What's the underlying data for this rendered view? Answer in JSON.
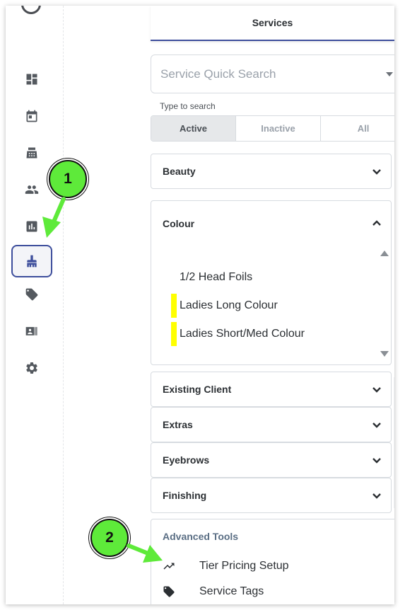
{
  "sidebar": {
    "items": [
      {
        "name": "dashboard-icon"
      },
      {
        "name": "calendar-icon"
      },
      {
        "name": "cash-register-icon"
      },
      {
        "name": "clients-icon"
      },
      {
        "name": "reports-icon"
      },
      {
        "name": "services-brush-icon",
        "active": true
      },
      {
        "name": "tag-icon"
      },
      {
        "name": "contact-barcode-icon"
      },
      {
        "name": "gear-icon"
      }
    ]
  },
  "header": {
    "tab_label": "Services"
  },
  "search": {
    "placeholder": "Service Quick Search",
    "hint": "Type to search"
  },
  "filters": {
    "active": "Active",
    "inactive": "Inactive",
    "all": "All",
    "selected": "Active"
  },
  "categories": {
    "beauty": "Beauty",
    "colour": "Colour",
    "existing_client": "Existing Client",
    "extras": "Extras",
    "eyebrows": "Eyebrows",
    "finishing": "Finishing"
  },
  "colour_services": [
    {
      "label": "1/2 Head Foils",
      "highlighted": false
    },
    {
      "label": "Ladies Long Colour",
      "highlighted": true
    },
    {
      "label": "Ladies Short/Med Colour",
      "highlighted": true
    }
  ],
  "advanced_tools": {
    "title": "Advanced Tools",
    "tier_pricing": "Tier Pricing Setup",
    "service_tags": "Service Tags"
  },
  "callouts": {
    "one": "1",
    "two": "2"
  },
  "colors": {
    "accent": "#3d4e9c",
    "highlight": "#ffff00",
    "callout": "#5eea3a"
  }
}
